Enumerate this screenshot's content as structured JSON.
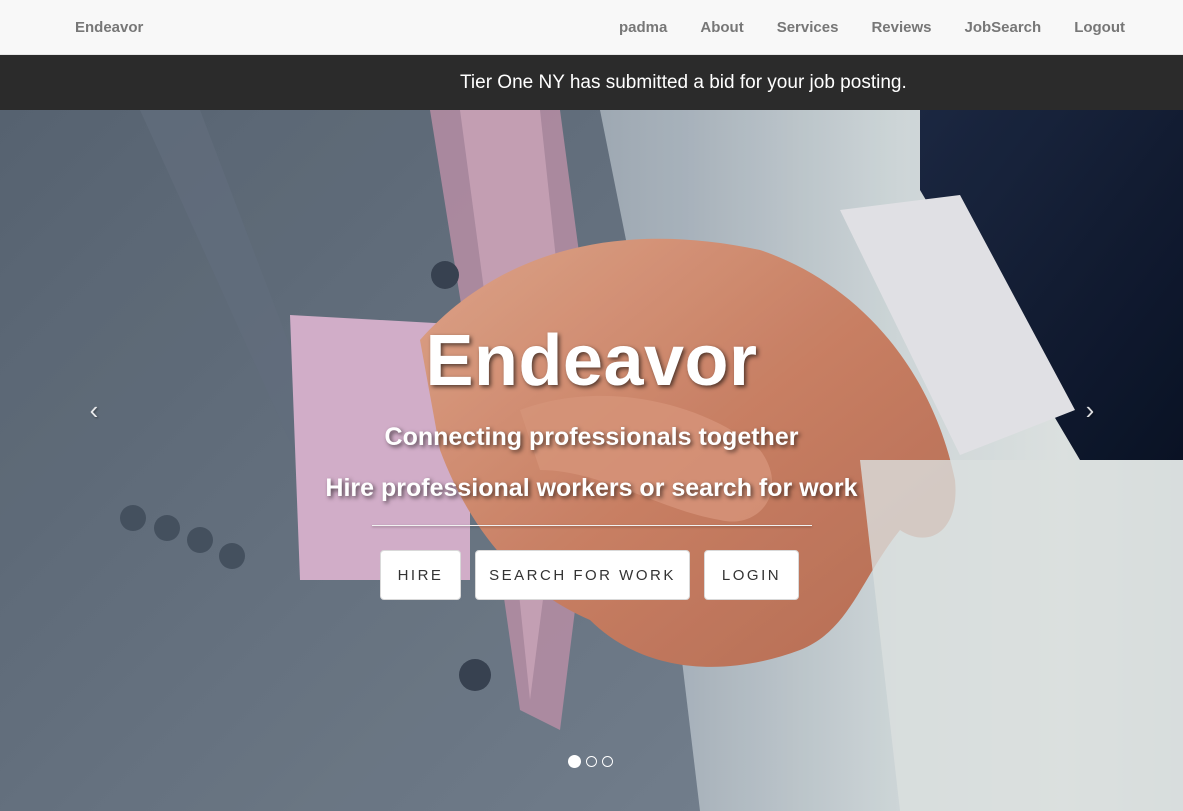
{
  "navbar": {
    "brand": "Endeavor",
    "links": [
      "padma",
      "About",
      "Services",
      "Reviews",
      "JobSearch",
      "Logout"
    ]
  },
  "notification": {
    "message": "Tier One NY has submitted a bid for your job posting."
  },
  "hero": {
    "title": "Endeavor",
    "subtitle_1": "Connecting professionals together",
    "subtitle_2": "Hire professional workers or search for work",
    "buttons": {
      "hire": "HIRE",
      "search_for_work": "SEARCH FOR WORK",
      "login": "LOGIN"
    },
    "prev_arrow": "‹",
    "next_arrow": "›",
    "slide_count": 3,
    "active_slide": 1
  },
  "colors": {
    "navbar_bg": "#f8f8f8",
    "navbar_text": "#777777",
    "notice_bg": "#2b2b2b",
    "hero_text": "#ffffff",
    "button_bg": "#ffffff"
  }
}
